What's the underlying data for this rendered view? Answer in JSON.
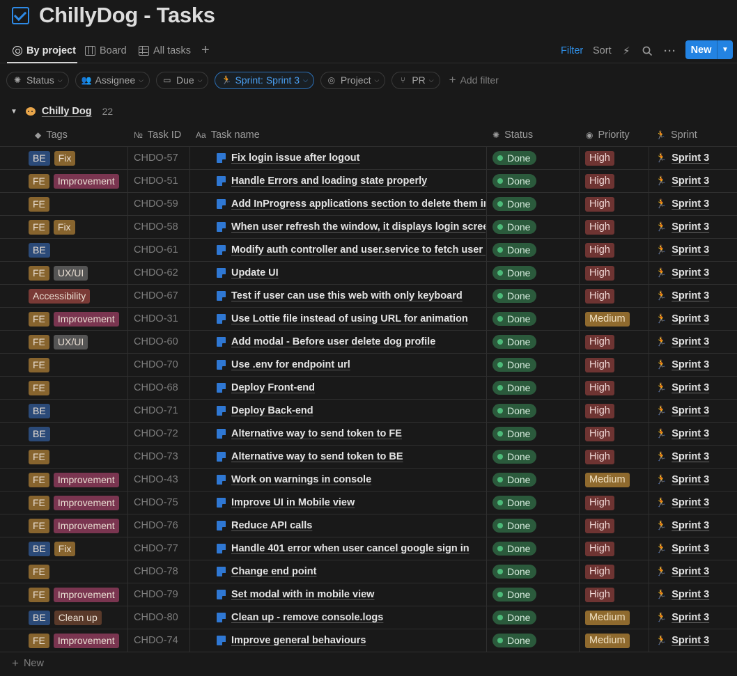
{
  "page": {
    "title": "ChillyDog - Tasks"
  },
  "views": {
    "tabs": [
      {
        "label": "By project",
        "icon": "target-icon",
        "active": true
      },
      {
        "label": "Board",
        "icon": "board-icon",
        "active": false
      },
      {
        "label": "All tasks",
        "icon": "table-icon",
        "active": false
      }
    ],
    "filter_label": "Filter",
    "sort_label": "Sort",
    "new_label": "New"
  },
  "filters": [
    {
      "label": "Status",
      "icon": "status-icon",
      "active": false
    },
    {
      "label": "Assignee",
      "icon": "people-icon",
      "active": false
    },
    {
      "label": "Due",
      "icon": "calendar-icon",
      "active": false
    },
    {
      "label": "Sprint: Sprint 3",
      "icon": "sprint-icon",
      "active": true
    },
    {
      "label": "Project",
      "icon": "target-icon",
      "active": false
    },
    {
      "label": "PR",
      "icon": "branch-icon",
      "active": false
    }
  ],
  "add_filter_label": "Add filter",
  "group": {
    "name": "Chilly Dog",
    "count": "22"
  },
  "columns": {
    "tags": "Tags",
    "task_id": "Task ID",
    "task_name": "Task name",
    "status": "Status",
    "priority": "Priority",
    "sprint": "Sprint"
  },
  "tag_colors": {
    "BE": "#2b4a78",
    "FE": "#87642e",
    "Fix": "#87642e",
    "Improvement": "#7a3550",
    "UX/UI": "#555555",
    "Accessibility": "#7a3a36",
    "Clean up": "#5a3a2a"
  },
  "priority_colors": {
    "High": "#6e3432",
    "Medium": "#8f6a2e"
  },
  "rows": [
    {
      "tags": [
        "BE",
        "Fix"
      ],
      "id": "CHDO-57",
      "name": "Fix login issue after logout",
      "status": "Done",
      "priority": "High",
      "sprint": "Sprint 3"
    },
    {
      "tags": [
        "FE",
        "Improvement"
      ],
      "id": "CHDO-51",
      "name": "Handle Errors and loading state properly",
      "status": "Done",
      "priority": "High",
      "sprint": "Sprint 3"
    },
    {
      "tags": [
        "FE"
      ],
      "id": "CHDO-59",
      "name": "Add InProgress applications section to delete them in us",
      "status": "Done",
      "priority": "High",
      "sprint": "Sprint 3"
    },
    {
      "tags": [
        "FE",
        "Fix"
      ],
      "id": "CHDO-58",
      "name": "When user refresh the window, it displays login screen.",
      "status": "Done",
      "priority": "High",
      "sprint": "Sprint 3"
    },
    {
      "tags": [
        "BE"
      ],
      "id": "CHDO-61",
      "name": "Modify auth controller and user.service to fetch user dat",
      "status": "Done",
      "priority": "High",
      "sprint": "Sprint 3"
    },
    {
      "tags": [
        "FE",
        "UX/UI"
      ],
      "id": "CHDO-62",
      "name": "Update UI",
      "status": "Done",
      "priority": "High",
      "sprint": "Sprint 3"
    },
    {
      "tags": [
        "Accessibility"
      ],
      "id": "CHDO-67",
      "name": "Test if user can use this web with only keyboard",
      "status": "Done",
      "priority": "High",
      "sprint": "Sprint 3"
    },
    {
      "tags": [
        "FE",
        "Improvement"
      ],
      "id": "CHDO-31",
      "name": "Use Lottie file instead of using URL for animation",
      "status": "Done",
      "priority": "Medium",
      "sprint": "Sprint 3"
    },
    {
      "tags": [
        "FE",
        "UX/UI"
      ],
      "id": "CHDO-60",
      "name": "Add modal - Before user delete dog profile",
      "status": "Done",
      "priority": "High",
      "sprint": "Sprint 3"
    },
    {
      "tags": [
        "FE"
      ],
      "id": "CHDO-70",
      "name": "Use .env for endpoint url",
      "status": "Done",
      "priority": "High",
      "sprint": "Sprint 3"
    },
    {
      "tags": [
        "FE"
      ],
      "id": "CHDO-68",
      "name": "Deploy Front-end",
      "status": "Done",
      "priority": "High",
      "sprint": "Sprint 3"
    },
    {
      "tags": [
        "BE"
      ],
      "id": "CHDO-71",
      "name": "Deploy Back-end",
      "status": "Done",
      "priority": "High",
      "sprint": "Sprint 3"
    },
    {
      "tags": [
        "BE"
      ],
      "id": "CHDO-72",
      "name": "Alternative way to send token to FE",
      "status": "Done",
      "priority": "High",
      "sprint": "Sprint 3"
    },
    {
      "tags": [
        "FE"
      ],
      "id": "CHDO-73",
      "name": "Alternative way to send token to BE",
      "status": "Done",
      "priority": "High",
      "sprint": "Sprint 3"
    },
    {
      "tags": [
        "FE",
        "Improvement"
      ],
      "id": "CHDO-43",
      "name": "Work on warnings in console",
      "status": "Done",
      "priority": "Medium",
      "sprint": "Sprint 3"
    },
    {
      "tags": [
        "FE",
        "Improvement"
      ],
      "id": "CHDO-75",
      "name": "Improve UI in Mobile view",
      "status": "Done",
      "priority": "High",
      "sprint": "Sprint 3"
    },
    {
      "tags": [
        "FE",
        "Improvement"
      ],
      "id": "CHDO-76",
      "name": "Reduce API calls",
      "status": "Done",
      "priority": "High",
      "sprint": "Sprint 3"
    },
    {
      "tags": [
        "BE",
        "Fix"
      ],
      "id": "CHDO-77",
      "name": "Handle 401 error when user cancel google sign in",
      "status": "Done",
      "priority": "High",
      "sprint": "Sprint 3"
    },
    {
      "tags": [
        "FE"
      ],
      "id": "CHDO-78",
      "name": "Change end point",
      "status": "Done",
      "priority": "High",
      "sprint": "Sprint 3"
    },
    {
      "tags": [
        "FE",
        "Improvement"
      ],
      "id": "CHDO-79",
      "name": "Set modal with in mobile view",
      "status": "Done",
      "priority": "High",
      "sprint": "Sprint 3"
    },
    {
      "tags": [
        "BE",
        "Clean up"
      ],
      "id": "CHDO-80",
      "name": "Clean up - remove console.logs",
      "status": "Done",
      "priority": "Medium",
      "sprint": "Sprint 3"
    },
    {
      "tags": [
        "FE",
        "Improvement"
      ],
      "id": "CHDO-74",
      "name": "Improve general behaviours",
      "status": "Done",
      "priority": "Medium",
      "sprint": "Sprint 3"
    }
  ],
  "new_row_label": "New"
}
